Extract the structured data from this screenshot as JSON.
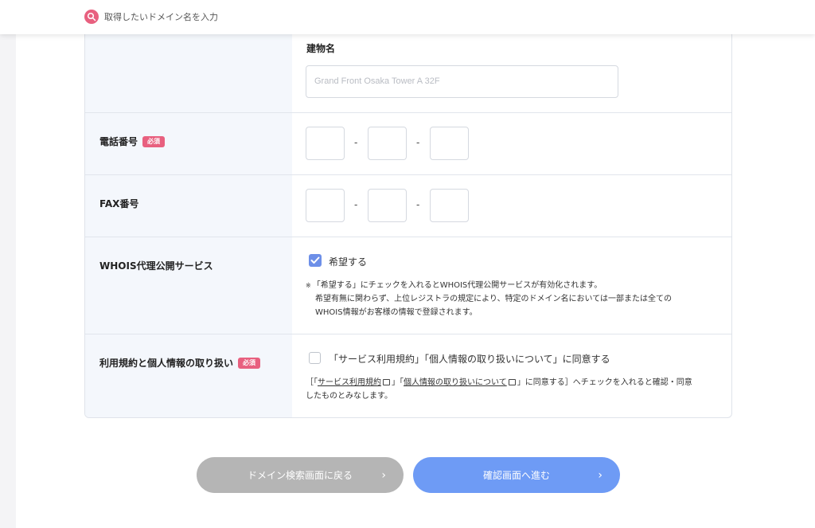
{
  "search": {
    "placeholder": "取得したいドメイン名を入力"
  },
  "building": {
    "title": "建物名",
    "placeholder": "Grand Front Osaka Tower A 32F"
  },
  "phone": {
    "label": "電話番号",
    "badge": "必須",
    "separator": "-"
  },
  "fax": {
    "label": "FAX番号",
    "separator": "-"
  },
  "whois": {
    "label": "WHOIS代理公開サービス",
    "checkbox_label": "希望する",
    "checked": true,
    "note_mark": "※",
    "note_line1": "「希望する」にチェックを入れるとWHOIS代理公開サービスが有効化されます。",
    "note_line2": "希望有無に関わらず、上位レジストラの規定により、特定のドメイン名においては一部または全ての",
    "note_line3": "WHOIS情報がお客様の情報で登録されます。"
  },
  "terms": {
    "label": "利用規約と個人情報の取り扱い",
    "badge": "必須",
    "checkbox_label": "「サービス利用規約」「個人情報の取り扱いについて」に同意する",
    "checked": false,
    "note_open": "［「",
    "note_link1": "サービス利用規約",
    "note_mid": "」「",
    "note_link2": "個人情報の取り扱いについて",
    "note_tail": "」に同意する］へチェックを入れると確認・同意",
    "note_line2": "したものとみなします。"
  },
  "buttons": {
    "back": "ドメイン検索画面に戻る",
    "next": "確認画面へ進む"
  },
  "colors": {
    "accent_pink": "#e8607f",
    "primary_blue": "#6e9bf5",
    "disabled_gray": "#b5b5b5",
    "label_bg": "#f4f7fc"
  },
  "icons": {
    "search": "search-icon",
    "check": "check-icon",
    "chevron": "chevron-right-icon",
    "external": "external-link-icon"
  }
}
